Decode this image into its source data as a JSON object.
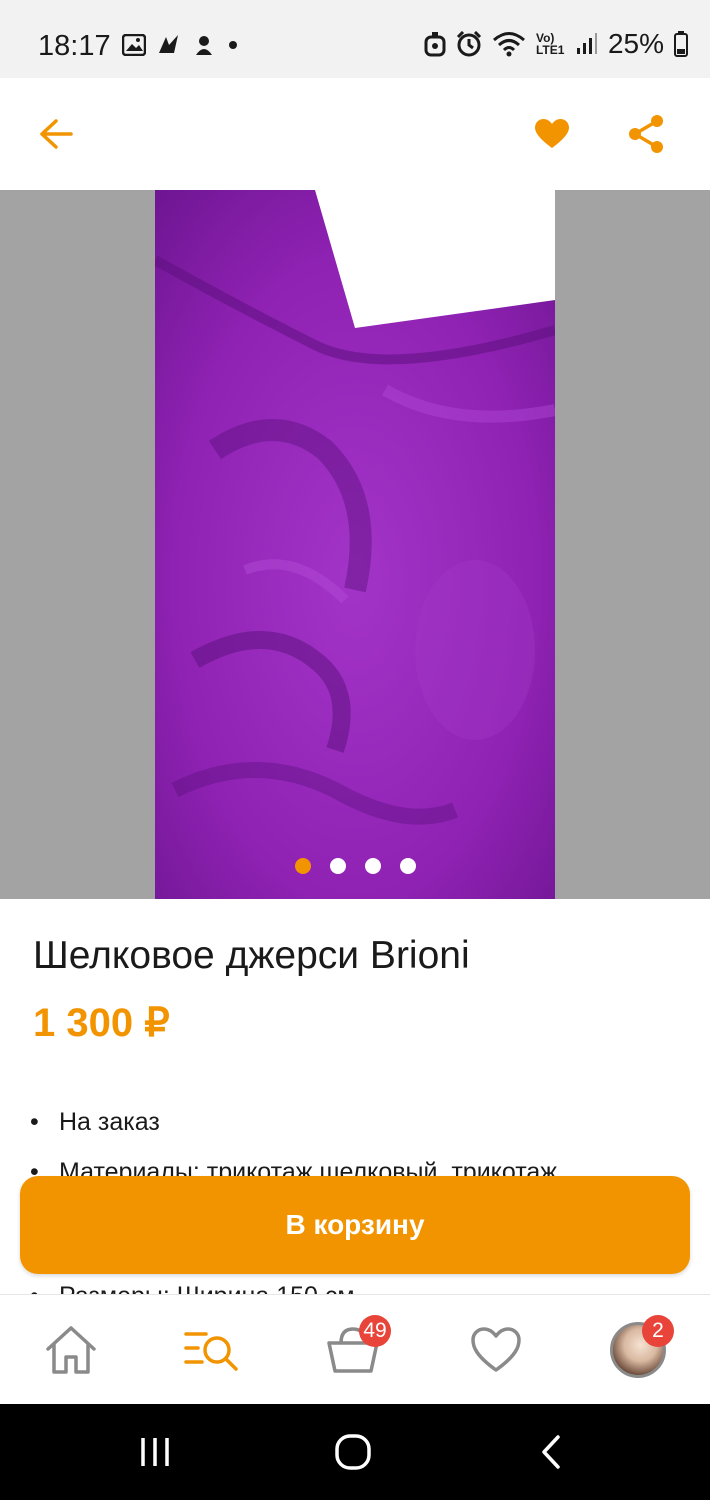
{
  "status_bar": {
    "time": "18:17",
    "network_label": "Vo) LTE1",
    "battery": "25%",
    "icons": [
      "gallery-icon",
      "app-icon",
      "app-icon-2",
      "dot-icon",
      "alarm-icon",
      "clock-icon",
      "wifi-icon",
      "signal-icon",
      "battery-icon"
    ]
  },
  "top_bar": {
    "back_icon": "arrow-left-icon",
    "favorite_icon": "heart-filled-icon",
    "share_icon": "share-icon"
  },
  "gallery": {
    "image_description_icon": "fabric-photo",
    "page_count": 4,
    "active_index": 0
  },
  "product": {
    "title": "Шелковое джерси Brioni",
    "price": "1 300 ₽"
  },
  "description": {
    "items": [
      "На заказ",
      "Материалы: трикотаж шелковый, трикотаж",
      "Размеры: Ширина 150 см"
    ]
  },
  "actions": {
    "add_to_cart": "В корзину"
  },
  "bottom_nav": {
    "home_icon": "home-icon",
    "catalog_icon": "search-list-icon",
    "cart_icon": "cart-icon",
    "cart_badge": "49",
    "favorites_icon": "heart-outline-icon",
    "profile_icon": "avatar",
    "profile_badge": "2"
  },
  "colors": {
    "accent": "#f29400",
    "badge": "#e8443a",
    "gallery_bg": "#a3a3a3",
    "fabric": "#8f22b3"
  }
}
